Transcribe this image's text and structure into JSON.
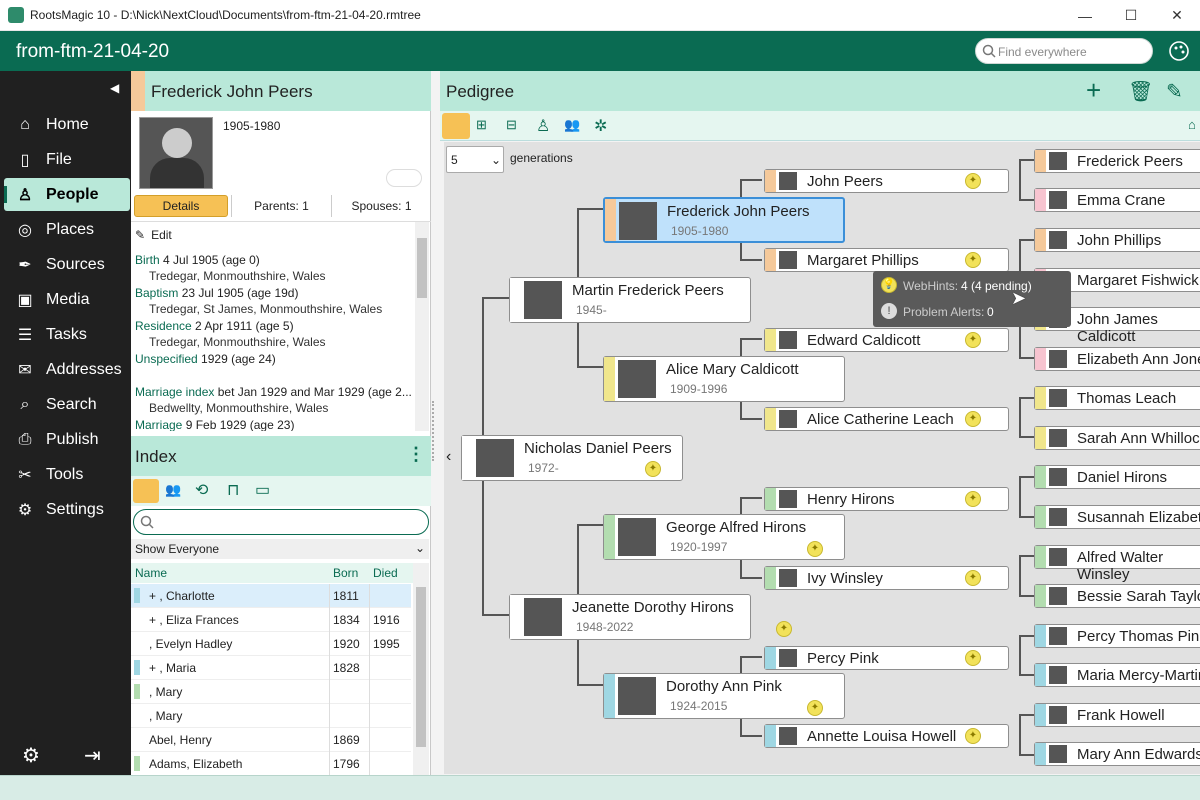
{
  "window": {
    "title": "RootsMagic 10 - D:\\Nick\\NextCloud\\Documents\\from-ftm-21-04-20.rmtree"
  },
  "app": {
    "file_title": "from-ftm-21-04-20",
    "search_placeholder": "Find everywhere"
  },
  "nav": [
    {
      "label": "Home",
      "icon": "home-icon"
    },
    {
      "label": "File",
      "icon": "file-icon"
    },
    {
      "label": "People",
      "icon": "person-icon",
      "active": true
    },
    {
      "label": "Places",
      "icon": "globe-icon"
    },
    {
      "label": "Sources",
      "icon": "pen-icon"
    },
    {
      "label": "Media",
      "icon": "image-icon"
    },
    {
      "label": "Tasks",
      "icon": "tasks-icon"
    },
    {
      "label": "Addresses",
      "icon": "envelope-icon"
    },
    {
      "label": "Search",
      "icon": "search-icon"
    },
    {
      "label": "Publish",
      "icon": "printer-icon"
    },
    {
      "label": "Tools",
      "icon": "tools-icon"
    },
    {
      "label": "Settings",
      "icon": "gear-icon"
    }
  ],
  "person": {
    "name": "Frederick John Peers",
    "dates": "1905-1980",
    "tabs": [
      "Details",
      "Parents: 1",
      "Spouses: 1"
    ],
    "edit_label": "Edit",
    "events": [
      {
        "label": "Birth",
        "text": "4 Jul 1905 (age 0)",
        "place": "Tredegar, Monmouthshire, Wales"
      },
      {
        "label": "Baptism",
        "text": "23 Jul 1905 (age 19d)",
        "place": "Tredegar, St James, Monmouthshire, Wales"
      },
      {
        "label": "Residence",
        "text": "2 Apr 1911 (age 5)",
        "place": "Tredegar, Monmouthshire, Wales"
      },
      {
        "label": "Unspecified",
        "text": "1929 (age 24)",
        "place": ""
      },
      {
        "label": "Marriage index",
        "text": "bet Jan 1929 and Mar 1929 (age 2...",
        "place": "Bedwellty, Monmouthshire, Wales"
      },
      {
        "label": "Marriage",
        "text": "9 Feb 1929 (age 23)",
        "place": "Bedwellty, Monmouthshire, Wales"
      }
    ]
  },
  "index": {
    "title": "Index",
    "filter": "Show Everyone",
    "columns": [
      "Name",
      "Born",
      "Died"
    ],
    "rows": [
      {
        "name": "+ , Charlotte",
        "born": "1811",
        "died": "",
        "color": "#9fd7e3",
        "selected": true
      },
      {
        "name": "+ , Eliza Frances",
        "born": "1834",
        "died": "1916",
        "color": ""
      },
      {
        "name": ", Evelyn Hadley",
        "born": "1920",
        "died": "1995",
        "color": ""
      },
      {
        "name": "+ , Maria",
        "born": "1828",
        "died": "",
        "color": "#9fd7e3"
      },
      {
        "name": ", Mary",
        "born": "",
        "died": "",
        "color": "#b3ddb0"
      },
      {
        "name": ", Mary",
        "born": "",
        "died": "",
        "color": ""
      },
      {
        "name": "Abel, Henry",
        "born": "1869",
        "died": "",
        "color": ""
      },
      {
        "name": "Adams, Elizabeth",
        "born": "1796",
        "died": "",
        "color": "#b3ddb0"
      }
    ]
  },
  "pedigree": {
    "title": "Pedigree",
    "generations_value": "5",
    "generations_label": "generations",
    "tooltip": {
      "webhints_label": "WebHints:",
      "webhints_value": "4 (4 pending)",
      "alerts_label": "Problem Alerts:",
      "alerts_value": "0"
    },
    "people": {
      "root": {
        "name": "Nicholas Daniel Peers",
        "dates": "1972-"
      },
      "f": {
        "name": "Martin Frederick Peers",
        "dates": "1945-"
      },
      "m": {
        "name": "Jeanette Dorothy Hirons",
        "dates": "1948-2022"
      },
      "ff": {
        "name": "Frederick John Peers",
        "dates": "1905-1980"
      },
      "fm": {
        "name": "Alice Mary Caldicott",
        "dates": "1909-1996"
      },
      "mf": {
        "name": "George Alfred Hirons",
        "dates": "1920-1997"
      },
      "mm": {
        "name": "Dorothy Ann Pink",
        "dates": "1924-2015"
      },
      "g1": {
        "name": "John Peers"
      },
      "g2": {
        "name": "Margaret Phillips"
      },
      "g3": {
        "name": "Edward Caldicott"
      },
      "g4": {
        "name": "Alice Catherine Leach"
      },
      "g5": {
        "name": "Henry Hirons"
      },
      "g6": {
        "name": "Ivy Winsley"
      },
      "g7": {
        "name": "Percy Pink"
      },
      "g8": {
        "name": "Annette Louisa Howell"
      },
      "h1": {
        "name": "Frederick Peers"
      },
      "h2": {
        "name": "Emma Crane"
      },
      "h3": {
        "name": "John Phillips"
      },
      "h4": {
        "name": "Margaret Fishwick"
      },
      "h5": {
        "name": "John James Caldicott"
      },
      "h6": {
        "name": "Elizabeth Ann Jones"
      },
      "h7": {
        "name": "Thomas Leach"
      },
      "h8": {
        "name": "Sarah Ann Whillock"
      },
      "h9": {
        "name": "Daniel Hirons"
      },
      "h10": {
        "name": "Susannah Elizabeth"
      },
      "h11": {
        "name": "Alfred Walter Winsley"
      },
      "h12": {
        "name": "Bessie Sarah Taylor"
      },
      "h13": {
        "name": "Percy Thomas Pink"
      },
      "h14": {
        "name": "Maria Mercy-Martin"
      },
      "h15": {
        "name": "Frank Howell"
      },
      "h16": {
        "name": "Mary Ann Edwards"
      }
    }
  },
  "colors": {
    "accent": "#0a6b52",
    "male": "#f5c99a",
    "female": "#f5c99a",
    "paternal": "#f5c99a",
    "yellow": "#f0e68c",
    "green": "#b3ddb0",
    "blue": "#9fd7e3",
    "pink": "#f7c4d0"
  }
}
